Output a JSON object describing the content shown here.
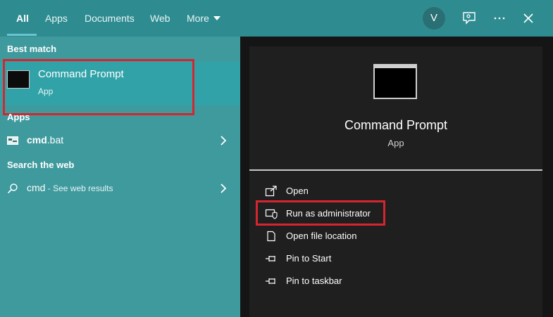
{
  "tabs": [
    {
      "label": "All",
      "active": true
    },
    {
      "label": "Apps"
    },
    {
      "label": "Documents"
    },
    {
      "label": "Web"
    },
    {
      "label": "More"
    }
  ],
  "header": {
    "avatar_initial": "V"
  },
  "sections": {
    "best_match": "Best match",
    "apps": "Apps",
    "search_web": "Search the web"
  },
  "best_match": {
    "title": "Command Prompt",
    "subtitle": "App"
  },
  "apps_items": [
    {
      "bold": "cmd",
      "rest": ".bat"
    }
  ],
  "web_items": [
    {
      "query": "cmd",
      "suffix": " - See web results"
    }
  ],
  "preview": {
    "title": "Command Prompt",
    "subtitle": "App"
  },
  "actions": [
    {
      "label": "Open",
      "icon": "open-icon"
    },
    {
      "label": "Run as administrator",
      "icon": "shield-icon"
    },
    {
      "label": "Open file location",
      "icon": "file-location-icon"
    },
    {
      "label": "Pin to Start",
      "icon": "pin-icon"
    },
    {
      "label": "Pin to taskbar",
      "icon": "pin-icon"
    }
  ],
  "colors": {
    "left_bg": "#3f9a9e",
    "selected_bg": "#31a3a8",
    "right_bg": "#1f1f1f",
    "highlight": "#d5262f"
  }
}
